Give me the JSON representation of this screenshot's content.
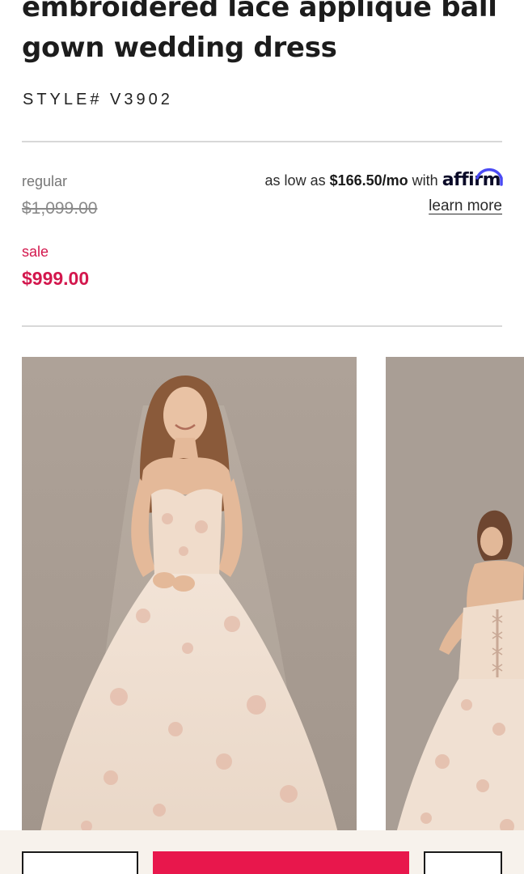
{
  "product": {
    "title": "embroidered lace applique ball gown wedding dress",
    "style_number": "STYLE# V3902"
  },
  "pricing": {
    "regular_label": "regular",
    "regular_price": "$1,099.00",
    "sale_label": "sale",
    "sale_price": "$999.00",
    "sale_color": "#d3174d"
  },
  "financing": {
    "prefix": "as low as",
    "amount": "$166.50/mo",
    "connector": "with",
    "provider": "affirm",
    "learn_more": "learn more"
  },
  "gallery": {
    "images": [
      {
        "alt": "Model in strapless sweetheart lace applique ball gown, front view"
      },
      {
        "alt": "Model in ball gown, back view showing corset lace-up"
      }
    ]
  },
  "actions": {
    "primary_color": "#e8174c"
  }
}
